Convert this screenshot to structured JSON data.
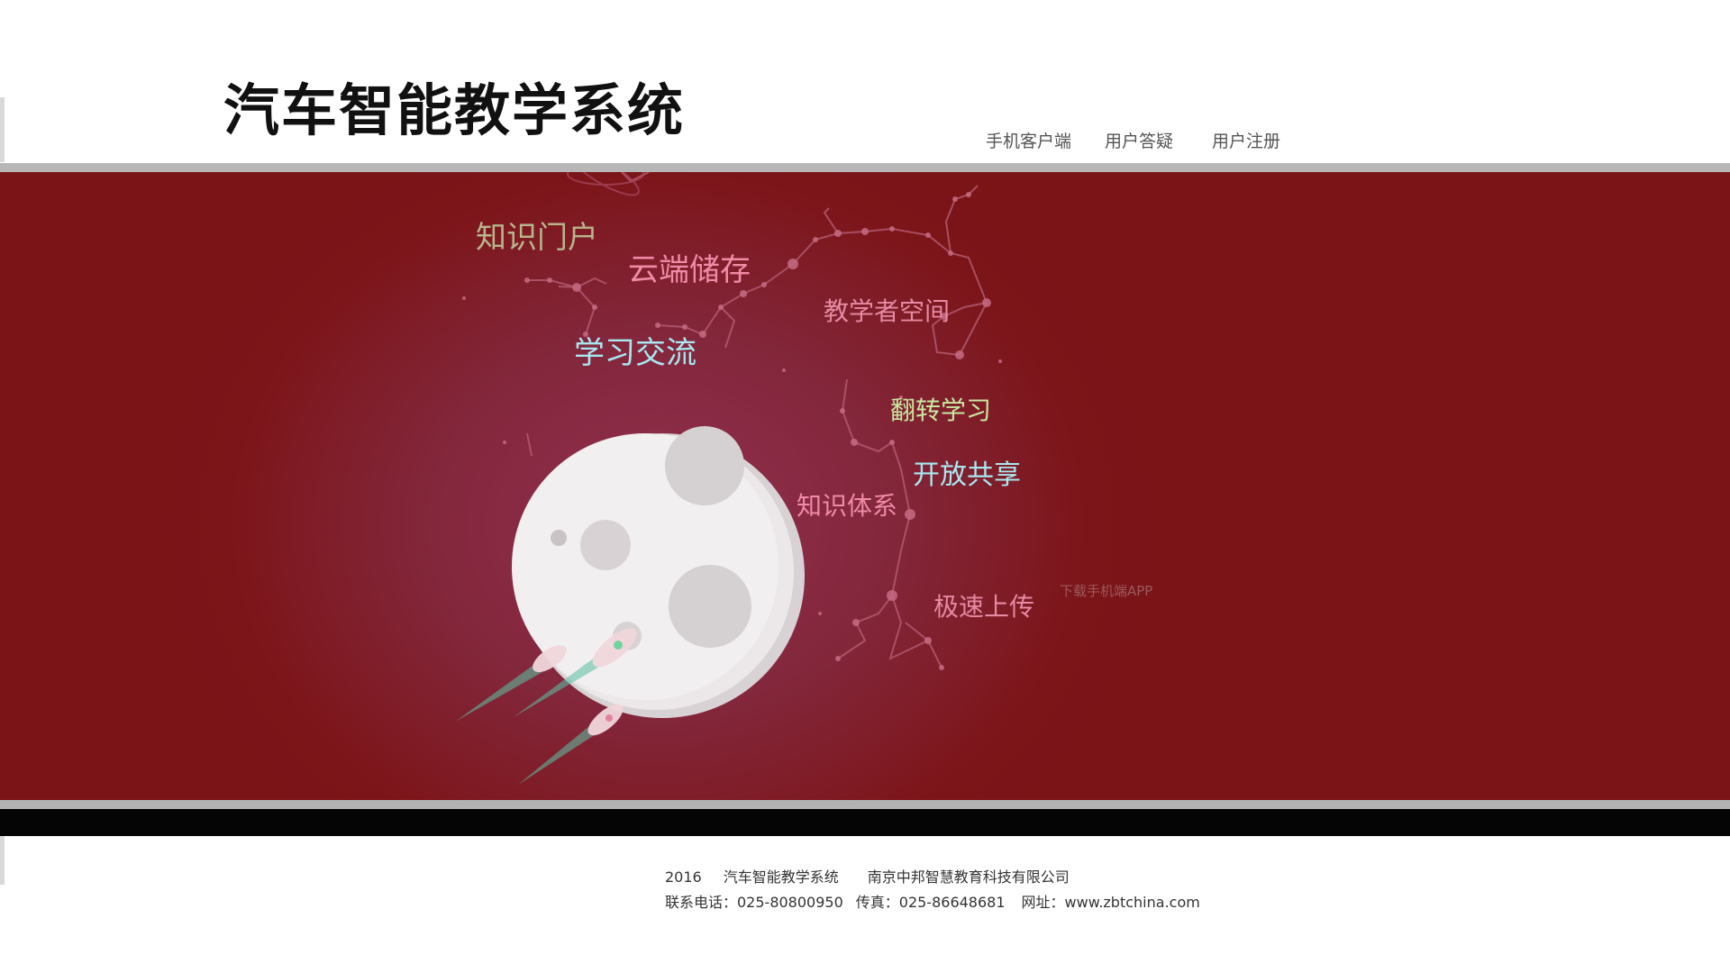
{
  "header": {
    "title": "汽车智能教学系统",
    "nav": [
      "手机客户端",
      "用户答疑",
      "用户注册"
    ]
  },
  "banner": {
    "labels": {
      "knowledge_portal": "知识门户",
      "cloud_storage": "云端储存",
      "teacher_space": "教学者空间",
      "learning_exchange": "学习交流",
      "flipped_learning": "翻转学习",
      "open_sharing": "开放共享",
      "knowledge_system": "知识体系",
      "fast_upload": "极速上传"
    },
    "download_app": "下载手机端APP",
    "colors": {
      "background": "#7c1519",
      "label_olive": "#b7b58c",
      "label_pink": "#f08aa6",
      "label_cyan": "#a9e6f0",
      "label_green": "#c8e8a0",
      "constellation": "#b15a6e"
    }
  },
  "footer": {
    "year": "2016",
    "system_name": "汽车智能教学系统",
    "company": "南京中邦智慧教育科技有限公司",
    "phone": "联系电话：025-80800950",
    "fax": "传真：025-86648681",
    "website": "网址：www.zbtchina.com"
  }
}
